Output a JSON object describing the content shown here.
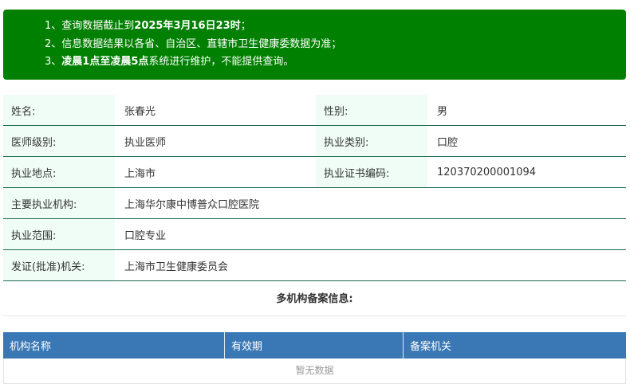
{
  "notice": {
    "lines": [
      {
        "prefix": "1、查询数据截止到",
        "bold": "2025年3月16日23时",
        "suffix": "；"
      },
      {
        "prefix": "2、信息数据结果以各省、自治区、直辖市卫生健康委数据为准；",
        "bold": "",
        "suffix": ""
      },
      {
        "prefix": "3、",
        "bold": "凌晨1点至凌晨5点",
        "suffix": "系统进行维护，不能提供查询。"
      }
    ]
  },
  "info": {
    "name_label": "姓名:",
    "name_value": "张春光",
    "gender_label": "性别:",
    "gender_value": "男",
    "level_label": "医师级别:",
    "level_value": "执业医师",
    "category_label": "执业类别:",
    "category_value": "口腔",
    "location_label": "执业地点:",
    "location_value": "上海市",
    "cert_label": "执业证书编码:",
    "cert_value": "120370200001094",
    "institution_label": "主要执业机构:",
    "institution_value": "上海华尔康中博普众口腔医院",
    "scope_label": "执业范围:",
    "scope_value": "口腔专业",
    "authority_label": "发证(批准)机关:",
    "authority_value": "上海市卫生健康委员会"
  },
  "multi": {
    "title": "多机构备案信息:",
    "columns": [
      "机构名称",
      "有效期",
      "备案机关"
    ],
    "empty_text": "暂无数据"
  },
  "colors": {
    "notice_bg": "#008000",
    "header_bg": "#3a78b5",
    "label_bg": "#f0fdf6",
    "row_border": "#1d6b52"
  }
}
